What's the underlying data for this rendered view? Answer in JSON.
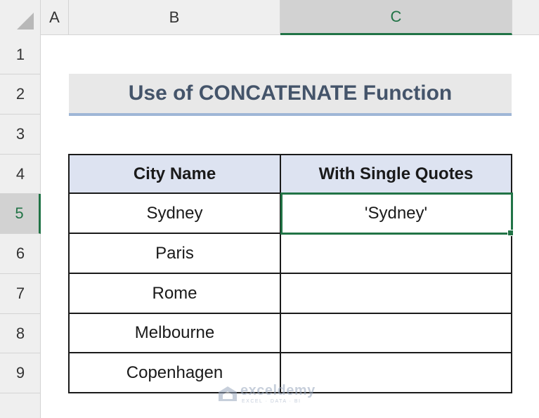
{
  "spreadsheet": {
    "columns": [
      "A",
      "B",
      "C"
    ],
    "active_column": "C",
    "rows": [
      "1",
      "2",
      "3",
      "4",
      "5",
      "6",
      "7",
      "8",
      "9"
    ],
    "active_row": "5"
  },
  "title": "Use of CONCATENATE Function",
  "table": {
    "headers": [
      "City Name",
      "With Single Quotes"
    ],
    "rows": [
      [
        "Sydney",
        "'Sydney'"
      ],
      [
        "Paris",
        ""
      ],
      [
        "Rome",
        ""
      ],
      [
        "Melbourne",
        ""
      ],
      [
        "Copenhagen",
        ""
      ]
    ]
  },
  "watermark": {
    "name": "exceldemy",
    "tagline": "EXCEL · DATA · BI"
  },
  "colors": {
    "accent_green": "#217346",
    "title_text": "#44546a",
    "header_fill": "#dde3f1"
  },
  "icons": [
    "select-all-triangle-icon",
    "exceldemy-logo-icon"
  ]
}
